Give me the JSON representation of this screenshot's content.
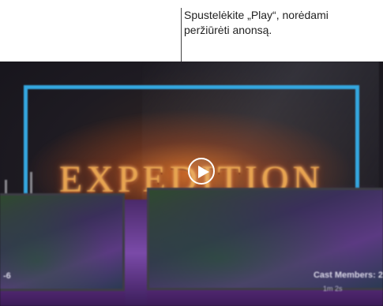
{
  "callout": {
    "line1": "Spustelėkite „Play“, norėdami",
    "line2": "peržiūrėti anonsą."
  },
  "preview": {
    "title_logo": "EXPEDITION",
    "left_label": "-6",
    "right_label": "Cast Members: 2",
    "right_sublabel": "1m 2s",
    "play_icon": "play-icon",
    "accent_blue": "#34a7df",
    "accent_purple": "#6b3591",
    "accent_orange": "#e7a350"
  }
}
